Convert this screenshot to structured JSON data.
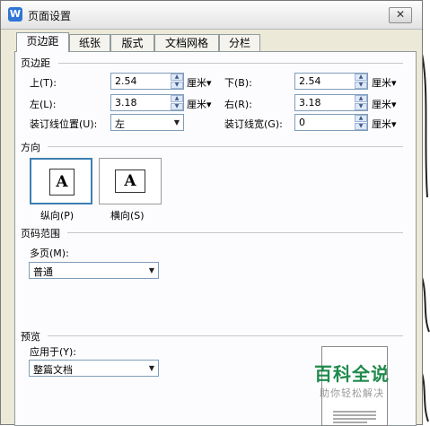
{
  "window": {
    "title": "页面设置",
    "app_icon": "W",
    "close": "✕"
  },
  "tabs": [
    {
      "label": "页边距"
    },
    {
      "label": "纸张"
    },
    {
      "label": "版式"
    },
    {
      "label": "文档网格"
    },
    {
      "label": "分栏"
    }
  ],
  "margins": {
    "title": "页边距",
    "top": {
      "label": "上(T):",
      "value": "2.54",
      "unit": "厘米▾"
    },
    "bottom": {
      "label": "下(B):",
      "value": "2.54",
      "unit": "厘米▾"
    },
    "left": {
      "label": "左(L):",
      "value": "3.18",
      "unit": "厘米▾"
    },
    "right": {
      "label": "右(R):",
      "value": "3.18",
      "unit": "厘米▾"
    },
    "gutter_pos": {
      "label": "装订线位置(U):",
      "value": "左"
    },
    "gutter_width": {
      "label": "装订线宽(G):",
      "value": "0",
      "unit": "厘米▾"
    }
  },
  "orientation": {
    "title": "方向",
    "portrait": {
      "label": "纵向(P)",
      "icon": "A"
    },
    "landscape": {
      "label": "横向(S)",
      "icon": "A"
    }
  },
  "page_range": {
    "title": "页码范围",
    "multi_label": "多页(M):",
    "multi_value": "普通"
  },
  "preview": {
    "title": "预览",
    "apply_label": "应用于(Y):",
    "apply_value": "整篇文档"
  },
  "watermark": {
    "title": "百科全说",
    "subtitle": "助你轻松解决"
  }
}
